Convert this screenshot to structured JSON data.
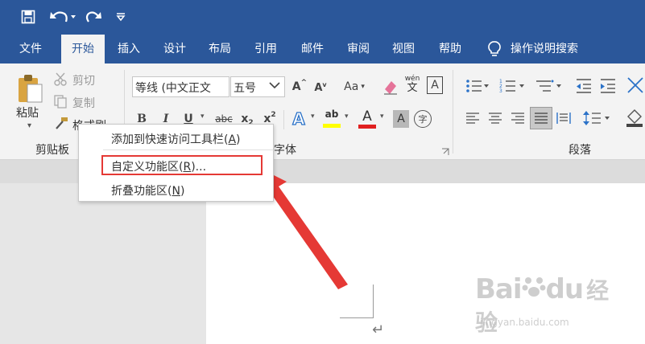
{
  "quick_access": {
    "save_icon": "save-icon",
    "undo_icon": "undo-icon",
    "redo_icon": "redo-icon",
    "customize_icon": "customize-qat-icon"
  },
  "tabs": [
    "文件",
    "开始",
    "插入",
    "设计",
    "布局",
    "引用",
    "邮件",
    "审阅",
    "视图",
    "帮助"
  ],
  "tell_me": {
    "label": "操作说明搜索",
    "icon": "lightbulb-icon"
  },
  "clipboard": {
    "paste_label": "粘贴",
    "cut_label": "剪切",
    "copy_label": "复制",
    "format_painter_label": "格式刷",
    "group_label": "剪贴板"
  },
  "font": {
    "font_name": "等线 (中文正文",
    "font_size": "五号",
    "group_label": "字体",
    "grow_label": "A",
    "shrink_label": "A",
    "case_label": "Aa",
    "phonetic_top": "wén",
    "phonetic_bottom": "文",
    "border_label": "A",
    "bold": "B",
    "italic": "I",
    "underline": "U",
    "strike": "abc",
    "subscript": "x",
    "subscript_index": "2",
    "superscript": "x",
    "superscript_index": "2",
    "effects": "A",
    "highlight": "ab",
    "color": "A",
    "shading": "A",
    "enclose": "字"
  },
  "paragraph": {
    "group_label": "段落"
  },
  "context_menu": {
    "items": [
      {
        "text": "添加到快速访问工具栏(",
        "key": "A",
        "suffix": ")"
      },
      {
        "text": "自定义功能区(",
        "key": "R",
        "suffix": ")..."
      },
      {
        "text": "折叠功能区(",
        "key": "N",
        "suffix": ")"
      }
    ]
  },
  "watermark": {
    "brand": "Bai",
    "brand2": "du",
    "cn": "经验",
    "url": "jingyan.baidu.com"
  },
  "colors": {
    "accent": "#2b579a",
    "highlight_box": "#e53935",
    "arrow": "#e53935"
  }
}
